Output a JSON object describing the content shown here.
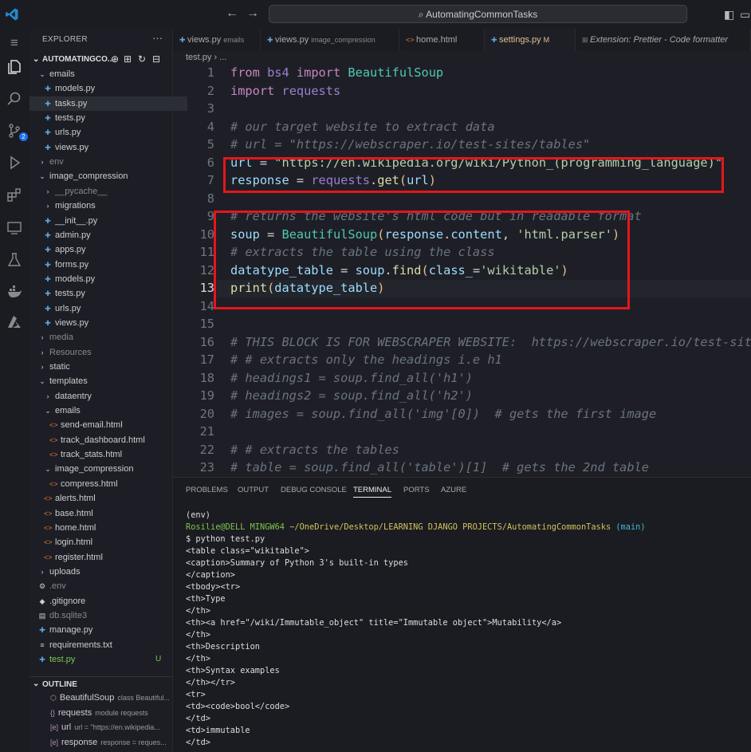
{
  "title_bar": {
    "search_text": "AutomatingCommonTasks",
    "back_glyph": "←",
    "forward_glyph": "→",
    "search_icon": "⌕",
    "layout_icons": [
      "◧",
      "▭",
      "◨"
    ]
  },
  "activity_bar": {
    "source_control_badge": "2"
  },
  "sidebar": {
    "header": "EXPLORER",
    "more_glyph": "···",
    "project_name": "AUTOMATINGCO...",
    "actions": [
      "⊕",
      "⊞",
      "↻",
      "⊟"
    ],
    "tree": [
      {
        "label": "emails",
        "kind": "folder-open",
        "indent": 1
      },
      {
        "label": "models.py",
        "kind": "py",
        "indent": 2
      },
      {
        "label": "tasks.py",
        "kind": "py",
        "indent": 2,
        "selected": true
      },
      {
        "label": "tests.py",
        "kind": "py",
        "indent": 2
      },
      {
        "label": "urls.py",
        "kind": "py",
        "indent": 2
      },
      {
        "label": "views.py",
        "kind": "py",
        "indent": 2
      },
      {
        "label": "env",
        "kind": "folder",
        "indent": 1,
        "dim": true
      },
      {
        "label": "image_compression",
        "kind": "folder-open",
        "indent": 1
      },
      {
        "label": "__pycache__",
        "kind": "folder",
        "indent": 2,
        "dim": true
      },
      {
        "label": "migrations",
        "kind": "folder",
        "indent": 2
      },
      {
        "label": "__init__.py",
        "kind": "py",
        "indent": 2
      },
      {
        "label": "admin.py",
        "kind": "py",
        "indent": 2
      },
      {
        "label": "apps.py",
        "kind": "py",
        "indent": 2
      },
      {
        "label": "forms.py",
        "kind": "py",
        "indent": 2
      },
      {
        "label": "models.py",
        "kind": "py",
        "indent": 2
      },
      {
        "label": "tests.py",
        "kind": "py",
        "indent": 2
      },
      {
        "label": "urls.py",
        "kind": "py",
        "indent": 2
      },
      {
        "label": "views.py",
        "kind": "py",
        "indent": 2
      },
      {
        "label": "media",
        "kind": "folder",
        "indent": 1,
        "dim": true
      },
      {
        "label": "Resources",
        "kind": "folder",
        "indent": 1,
        "dim": true
      },
      {
        "label": "static",
        "kind": "folder",
        "indent": 1
      },
      {
        "label": "templates",
        "kind": "folder-open",
        "indent": 1
      },
      {
        "label": "dataentry",
        "kind": "folder",
        "indent": 2
      },
      {
        "label": "emails",
        "kind": "folder-open",
        "indent": 2
      },
      {
        "label": "send-email.html",
        "kind": "html",
        "indent": 3
      },
      {
        "label": "track_dashboard.html",
        "kind": "html",
        "indent": 3
      },
      {
        "label": "track_stats.html",
        "kind": "html",
        "indent": 3
      },
      {
        "label": "image_compression",
        "kind": "folder-open",
        "indent": 2
      },
      {
        "label": "compress.html",
        "kind": "html",
        "indent": 3
      },
      {
        "label": "alerts.html",
        "kind": "html",
        "indent": 2
      },
      {
        "label": "base.html",
        "kind": "html",
        "indent": 2
      },
      {
        "label": "home.html",
        "kind": "html",
        "indent": 2
      },
      {
        "label": "login.html",
        "kind": "html",
        "indent": 2
      },
      {
        "label": "register.html",
        "kind": "html",
        "indent": 2
      },
      {
        "label": "uploads",
        "kind": "folder",
        "indent": 1
      },
      {
        "label": ".env",
        "kind": "gear",
        "indent": 1,
        "dim": true
      },
      {
        "label": ".gitignore",
        "kind": "git",
        "indent": 1
      },
      {
        "label": "db.sqlite3",
        "kind": "db",
        "indent": 1,
        "dim": true
      },
      {
        "label": "manage.py",
        "kind": "py",
        "indent": 1
      },
      {
        "label": "requirements.txt",
        "kind": "txt",
        "indent": 1
      },
      {
        "label": "test.py",
        "kind": "py",
        "indent": 1,
        "badge": "U",
        "active": true
      }
    ],
    "outline": {
      "header": "OUTLINE",
      "items": [
        {
          "icon": "⬡",
          "label": "BeautifulSoup",
          "detail": "class Beautiful..."
        },
        {
          "icon": "{}",
          "label": "requests",
          "detail": "module requests"
        },
        {
          "icon": "[e]",
          "label": "url",
          "detail": "url = \"https://en.wikipedia..."
        },
        {
          "icon": "[e]",
          "label": "response",
          "detail": "response = reques..."
        }
      ]
    }
  },
  "tabs": [
    {
      "label": "views.py",
      "detail": "emails"
    },
    {
      "label": "views.py",
      "detail": "image_compression"
    },
    {
      "label": "home.html",
      "detail": ""
    },
    {
      "label": "settings.py",
      "detail": "M",
      "active": true
    },
    {
      "label": "Extension: Prettier - Code formatter",
      "detail": ""
    }
  ],
  "breadcrumb": "test.py › ...",
  "editor": {
    "current_line": 13,
    "lines": [
      {
        "n": "1",
        "html": "<span class='k'>from</span> <span class='m'>bs4</span> <span class='k'>import</span> <span class='cl'>BeautifulSoup</span>"
      },
      {
        "n": "2",
        "html": "<span class='k'>import</span> <span class='m'>requests</span>"
      },
      {
        "n": "3",
        "html": ""
      },
      {
        "n": "4",
        "html": "<span class='c'># our target website to extract data</span>"
      },
      {
        "n": "5",
        "html": "<span class='c'># url = \"https://webscraper.io/test-sites/tables\"</span>"
      },
      {
        "n": "6",
        "html": "<span class='v'>url</span> = <span class='s'>\"https://en.wikipedia.org/wiki/Python_(programming_language)\"</span>"
      },
      {
        "n": "7",
        "html": "<span class='v'>response</span> = <span class='m'>requests</span>.<span class='f'>get</span><span class='p'>(</span><span class='v'>url</span><span class='p'>)</span>"
      },
      {
        "n": "8",
        "html": ""
      },
      {
        "n": "9",
        "html": "<span class='c'># returns the website's html code but in readable format</span>"
      },
      {
        "n": "10",
        "html": "<span class='v'>soup</span> = <span class='cl'>BeautifulSoup</span><span class='p'>(</span><span class='v'>response</span>.<span class='v'>content</span>, <span class='s'>'html.parser'</span><span class='p'>)</span>"
      },
      {
        "n": "11",
        "html": "<span class='c'># extracts the table using the class</span>"
      },
      {
        "n": "12",
        "html": "<span class='v'>datatype_table</span> = <span class='v'>soup</span>.<span class='f'>find</span><span class='p'>(</span><span class='v'>class_</span>=<span class='s'>'wikitable'</span><span class='p'>)</span>"
      },
      {
        "n": "13",
        "html": "<span class='f'>print</span><span class='p'>(</span><span class='v'>datatype_table</span><span class='p'>)</span>"
      },
      {
        "n": "14",
        "html": ""
      },
      {
        "n": "15",
        "html": ""
      },
      {
        "n": "16",
        "html": "<span class='c'># THIS BLOCK IS FOR WEBSCRAPER WEBSITE:  https://webscraper.io/test-sites/tables</span>"
      },
      {
        "n": "17",
        "html": "<span class='c'># # extracts only the headings i.e h1</span>"
      },
      {
        "n": "18",
        "html": "<span class='c'># headings1 = soup.find_all('h1')</span>"
      },
      {
        "n": "19",
        "html": "<span class='c'># headings2 = soup.find_all('h2')</span>"
      },
      {
        "n": "20",
        "html": "<span class='c'># images = soup.find_all('img'[0])  # gets the first image</span>"
      },
      {
        "n": "21",
        "html": ""
      },
      {
        "n": "22",
        "html": "<span class='c'># # extracts the tables</span>"
      },
      {
        "n": "23",
        "html": "<span class='c'># table = soup.find_all('table')[1]  # gets the 2nd table</span>"
      }
    ]
  },
  "panel": {
    "tabs": [
      {
        "label": "PROBLEMS"
      },
      {
        "label": "OUTPUT"
      },
      {
        "label": "DEBUG CONSOLE"
      },
      {
        "label": "TERMINAL",
        "active": true
      },
      {
        "label": "PORTS"
      },
      {
        "label": "AZURE"
      }
    ],
    "terminal_lines": [
      {
        "html": "(env)"
      },
      {
        "html": "<span class='green'>Rosilie@DELL MINGW64</span> <span class='yellow'>~/OneDrive/Desktop/LEARNING DJANGO PROJECTS/AutomatingCommonTasks</span> <span class='cyan'>(main)</span>"
      },
      {
        "html": "$ python test.py"
      },
      {
        "html": "&lt;table class=\"wikitable\"&gt;"
      },
      {
        "html": "&lt;caption&gt;Summary of Python 3's built-in types"
      },
      {
        "html": "&lt;/caption&gt;"
      },
      {
        "html": "&lt;tbody&gt;&lt;tr&gt;"
      },
      {
        "html": "&lt;th&gt;Type"
      },
      {
        "html": "&lt;/th&gt;"
      },
      {
        "html": "&lt;th&gt;&lt;a href=\"/wiki/Immutable_object\" title=\"Immutable object\"&gt;Mutability&lt;/a&gt;"
      },
      {
        "html": "&lt;/th&gt;"
      },
      {
        "html": "&lt;th&gt;Description"
      },
      {
        "html": "&lt;/th&gt;"
      },
      {
        "html": "&lt;th&gt;Syntax examples"
      },
      {
        "html": "&lt;/th&gt;&lt;/tr&gt;"
      },
      {
        "html": "&lt;tr&gt;"
      },
      {
        "html": "&lt;td&gt;&lt;code&gt;bool&lt;/code&gt;"
      },
      {
        "html": "&lt;/td&gt;"
      },
      {
        "html": "&lt;td&gt;immutable"
      },
      {
        "html": "&lt;/td&gt;"
      }
    ]
  }
}
